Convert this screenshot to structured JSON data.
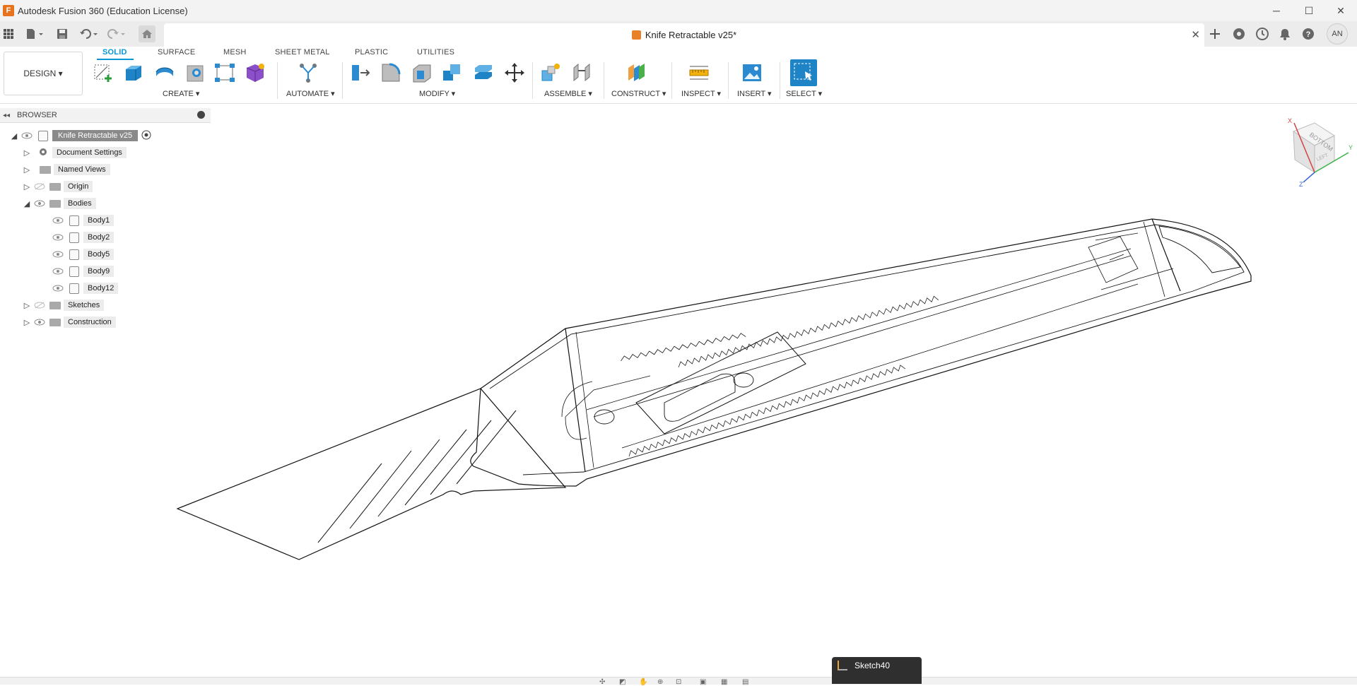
{
  "app": {
    "window_title": "Autodesk Fusion 360 (Education License)",
    "logo_glyph": "F",
    "brand_color": "#e8731d"
  },
  "window_controls": {
    "minimize": "─",
    "maximize": "☐",
    "close": "✕"
  },
  "document": {
    "title": "Knife Retractable v25*",
    "user_initials": "AN"
  },
  "ribbon": {
    "workspace": "DESIGN ▾",
    "tabs": [
      "SOLID",
      "SURFACE",
      "MESH",
      "SHEET METAL",
      "PLASTIC",
      "UTILITIES"
    ],
    "active_tab": "SOLID",
    "groups": [
      "CREATE ▾",
      "AUTOMATE ▾",
      "MODIFY ▾",
      "ASSEMBLE ▾",
      "CONSTRUCT ▾",
      "INSPECT ▾",
      "INSERT ▾",
      "SELECT ▾"
    ],
    "accent_color": "#0696d7"
  },
  "browser": {
    "title": "BROWSER",
    "root": "Knife Retractable v25",
    "items": [
      {
        "label": "Document Settings",
        "icon": "gear-icon"
      },
      {
        "label": "Named Views",
        "icon": "folder-icon"
      },
      {
        "label": "Origin",
        "icon": "folder-icon",
        "hidden": true
      },
      {
        "label": "Bodies",
        "icon": "folder-icon",
        "expanded": true
      },
      {
        "label": "Body1",
        "icon": "body-icon"
      },
      {
        "label": "Body2",
        "icon": "body-icon"
      },
      {
        "label": "Body5",
        "icon": "body-icon"
      },
      {
        "label": "Body9",
        "icon": "body-icon"
      },
      {
        "label": "Body12",
        "icon": "body-icon"
      },
      {
        "label": "Sketches",
        "icon": "folder-icon",
        "hidden": true
      },
      {
        "label": "Construction",
        "icon": "folder-icon"
      }
    ]
  },
  "viewcube": {
    "face_top": "BOTTOM",
    "face_front": "LEFT",
    "axis_x": "X",
    "axis_y": "Y",
    "axis_z": "Z"
  },
  "popup": {
    "item": "Sketch40"
  }
}
